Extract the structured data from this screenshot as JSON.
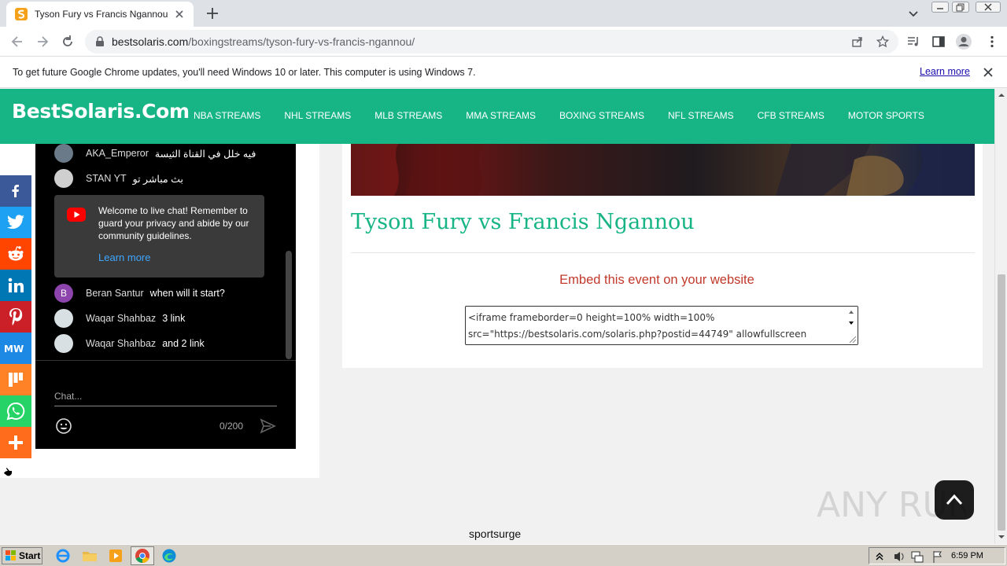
{
  "browser": {
    "tab_title": "Tyson Fury vs Francis Ngannou",
    "url_host": "bestsolaris.com",
    "url_path": "/boxingstreams/tyson-fury-vs-francis-ngannou/",
    "infobar_message": "To get future Google Chrome updates, you'll need Windows 10 or later. This computer is using Windows 7.",
    "infobar_link": "Learn more"
  },
  "site": {
    "logo": "BestSolaris.Com",
    "nav": [
      "NBA STREAMS",
      "NHL STREAMS",
      "MLB STREAMS",
      "MMA STREAMS",
      "BOXING STREAMS",
      "NFL STREAMS",
      "CFB STREAMS",
      "MOTOR SPORTS"
    ],
    "accent": "#17b486"
  },
  "chat": {
    "messages_top": [
      {
        "author": "AKA_Emperor",
        "text": "فيه خلل في القناة الثيسة"
      },
      {
        "author": "STAN YT",
        "text": "بث مباشر تو"
      }
    ],
    "welcome_text": "Welcome to live chat! Remember to guard your privacy and abide by our community guidelines.",
    "welcome_link": "Learn more",
    "messages_bottom": [
      {
        "author": "Beran Santur",
        "text": "when will it start?",
        "initial": "B"
      },
      {
        "author": "Waqar Shahbaz",
        "text": "3 link"
      },
      {
        "author": "Waqar Shahbaz",
        "text": "and 2 link"
      }
    ],
    "input_placeholder": "Chat...",
    "char_count": "0/200"
  },
  "social": [
    {
      "name": "facebook",
      "color": "#3b5998"
    },
    {
      "name": "twitter",
      "color": "#1da1f2"
    },
    {
      "name": "reddit",
      "color": "#ff4500"
    },
    {
      "name": "linkedin",
      "color": "#0077b5"
    },
    {
      "name": "pinterest",
      "color": "#cb2027"
    },
    {
      "name": "mewe",
      "color": "#1e88e5"
    },
    {
      "name": "mix",
      "color": "#ff8226"
    },
    {
      "name": "whatsapp",
      "color": "#25d366"
    },
    {
      "name": "more",
      "color": "#ff6c1b"
    }
  ],
  "content": {
    "title": "Tyson Fury vs Francis Ngannou",
    "embed_title": "Embed this event on your website",
    "embed_code_line1": "<iframe frameborder=0 height=100% width=100%",
    "embed_code_line2": "src=\"https://bestsolaris.com/solaris.php?postid=44749\" allowfullscreen"
  },
  "footer": {
    "text": "sportsurge"
  },
  "watermark": {
    "text": "ANY RUN"
  },
  "taskbar": {
    "start_label": "Start",
    "clock": "6:59 PM"
  }
}
